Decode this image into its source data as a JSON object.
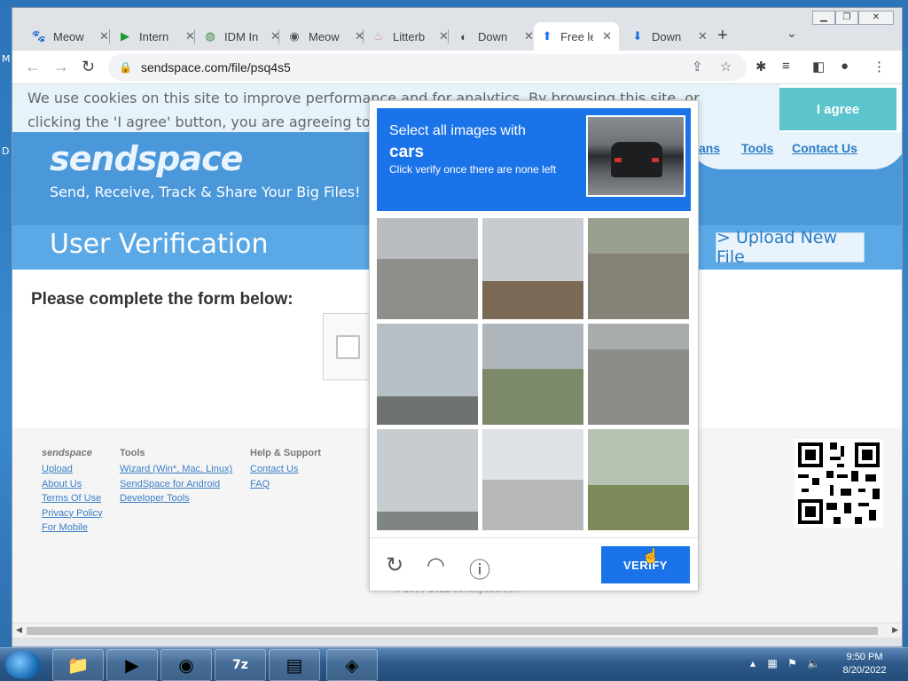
{
  "desktop": {
    "labels": [
      "M",
      "D"
    ]
  },
  "browser": {
    "tabs": [
      {
        "title": "Meow",
        "icon": "paw-icon"
      },
      {
        "title": "Intern",
        "icon": "play-icon"
      },
      {
        "title": "IDM In",
        "icon": "globe-icon"
      },
      {
        "title": "Meow",
        "icon": "chrome-icon"
      },
      {
        "title": "Litterb",
        "icon": "litter-icon"
      },
      {
        "title": "Down",
        "icon": "cat-icon"
      },
      {
        "title": "Free le",
        "icon": "upload-arrow-icon"
      },
      {
        "title": "Down",
        "icon": "download-arrow-icon"
      }
    ],
    "active_tab_index": 6,
    "url": "sendspace.com/file/psq4s5"
  },
  "page": {
    "cookie_text": "We use cookies on this site to improve performance and for analytics. By browsing this site, or clicking the 'I agree' button, you are agreeing to this. For more information s",
    "agree_label": "I agree",
    "logo": "sendspace",
    "tagline": "Send, Receive, Track & Share Your Big Files!",
    "top_links": [
      "ans",
      "Tools",
      "Contact Us"
    ],
    "verification_title": "User Verification",
    "upload_new_label": "> Upload New File",
    "form_heading": "Please complete the form below:",
    "footer": {
      "brand": "sendspace",
      "col1": [
        "Upload",
        "About Us",
        "Terms Of Use",
        "Privacy Policy",
        "For Mobile"
      ],
      "col2_title": "Tools",
      "col2": [
        "Wizard (Win*, Mac, Linux)",
        "SendSpace for Android",
        "Developer Tools"
      ],
      "col3_title": "Help & Support",
      "col3": [
        "Contact Us",
        "FAQ"
      ],
      "copyright": "© 2005-2022 sendspace.com"
    }
  },
  "captcha": {
    "line1": "Select all images with",
    "target": "cars",
    "subtitle": "Click verify once there are none left",
    "verify_label": "VERIFY",
    "tiles": [
      {
        "name": "tile-building-corner",
        "sky": "#b9bcbf",
        "ground": "#8e8f8a",
        "split": 40
      },
      {
        "name": "tile-trees-pole",
        "sky": "#c8ccd0",
        "ground": "#7a6a55",
        "split": 62
      },
      {
        "name": "tile-overpass",
        "sky": "#9aa08e",
        "ground": "#858377",
        "split": 35
      },
      {
        "name": "tile-traffic-light-city",
        "sky": "#b6bec6",
        "ground": "#6e7370",
        "split": 72
      },
      {
        "name": "tile-hill-tree",
        "sky": "#aeb6bb",
        "ground": "#7d8a6a",
        "split": 45
      },
      {
        "name": "tile-road-car",
        "sky": "#a8acac",
        "ground": "#8b8d88",
        "split": 25
      },
      {
        "name": "tile-palms",
        "sky": "#c7ccd0",
        "ground": "#7f8580",
        "split": 82
      },
      {
        "name": "tile-traffic-light",
        "sky": "#dfe2e4",
        "ground": "#b7b9b8",
        "split": 50
      },
      {
        "name": "tile-bridge-grass",
        "sky": "#b7c2b0",
        "ground": "#7d8a5a",
        "split": 55
      }
    ]
  },
  "taskbar": {
    "items": [
      "file-explorer-icon",
      "media-player-icon",
      "chrome-icon",
      "7zip-icon",
      "notepad-icon",
      "idm-icon"
    ],
    "time": "9:50 PM",
    "date": "8/20/2022"
  }
}
